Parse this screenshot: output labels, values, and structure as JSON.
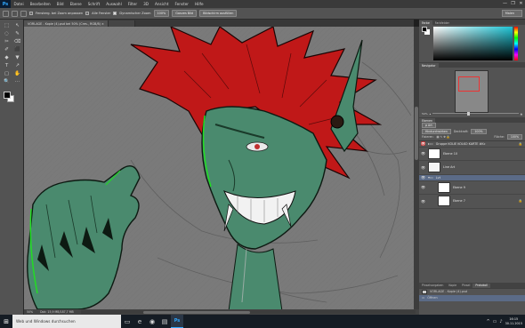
{
  "app": {
    "logo": "Ps"
  },
  "menu": [
    "Datei",
    "Bearbeiten",
    "Bild",
    "Ebene",
    "Schrift",
    "Auswahl",
    "Filter",
    "3D",
    "Ansicht",
    "Fenster",
    "Hilfe"
  ],
  "window_controls": [
    "—",
    "❐",
    "✕"
  ],
  "options": {
    "all_windows_label": "Fensterg. bei Zoom anpassen",
    "all_windows_checked": false,
    "zoom_all_label": "Alle Fenster",
    "zoom_all_checked": false,
    "scrubby_label": "Dynamischer Zoom",
    "scrubby_checked": true,
    "btn_100": "100%",
    "btn_fit": "Ganzes Bild",
    "btn_fill": "Bildschirm ausfüllen",
    "workspace": "Malen"
  },
  "doc_tabs": [
    {
      "label": "VORLAGE - Kopie (4).psd bei 50% (Cres., RGB/8) ×",
      "active": true
    },
    {
      "label": "",
      "active": false
    }
  ],
  "status": {
    "zoom": "50%",
    "doc_size": "Dok: 15,9 MB/187,7 MB"
  },
  "panels": {
    "color_tabs": [
      "Farbe",
      "Farbfelder"
    ],
    "navigator_tab": "Navigator",
    "navigator_zoom": "50%",
    "layers_tabs": [
      "Ebenen"
    ],
    "filter_kind": "ρ Art",
    "blend_mode": "Hindurchwirken",
    "opacity_label": "Deckkraft:",
    "opacity_value": "100%",
    "lock_label": "Fixieren:",
    "fill_label": "Fläche:",
    "fill_value": "100%",
    "layers": [
      {
        "name": "Gruppe KOLIE KOLKO KARTE #Kc",
        "type": "group",
        "visible": "red",
        "indent": 0,
        "selected": false,
        "locked": true
      },
      {
        "name": "Ebene 10",
        "type": "layer",
        "visible": "eye",
        "indent": 0,
        "selected": false,
        "locked": false
      },
      {
        "name": "Line Art",
        "type": "layer",
        "visible": "eye",
        "indent": 0,
        "selected": false,
        "locked": false
      },
      {
        "name": "Lvt",
        "type": "group",
        "visible": "eye",
        "indent": 0,
        "selected": true,
        "locked": false
      },
      {
        "name": "Ebene 9",
        "type": "layer",
        "visible": "eye",
        "indent": 1,
        "selected": false,
        "locked": false
      },
      {
        "name": "Ebene 7",
        "type": "layer",
        "visible": "eye",
        "indent": 1,
        "selected": false,
        "locked": true
      }
    ],
    "history_tabs": [
      "Pinselvorgaben",
      "Kopie",
      "Pinsel",
      "Protokoll"
    ],
    "history": [
      {
        "label": "VORLAGE - Kopie (4).psd",
        "active": false
      },
      {
        "label": "Öffnen",
        "active": true
      }
    ]
  },
  "taskbar": {
    "start_icon": "⊞",
    "search_placeholder": "Web und Windows durchsuchen",
    "task_icons": [
      "▭",
      "e",
      "◉",
      "▤",
      "Ps"
    ],
    "tray_icons": [
      "^",
      "▭",
      "♪"
    ],
    "time": "16:15",
    "date": "30.11.2015"
  },
  "tools": [
    "⬚",
    "↖",
    "◌",
    "✎",
    "✂",
    "⌫",
    "✐",
    "⬛",
    "◆",
    "▼",
    "T",
    "↗",
    "▢",
    "✋",
    "🔍",
    "⋯"
  ],
  "colors": {
    "skin": "#4a8a6e",
    "hair": "#c01818",
    "outline_glow": "#22dd22",
    "canvas_bg": "#7a7a7a",
    "selection": "#5b6b87"
  }
}
